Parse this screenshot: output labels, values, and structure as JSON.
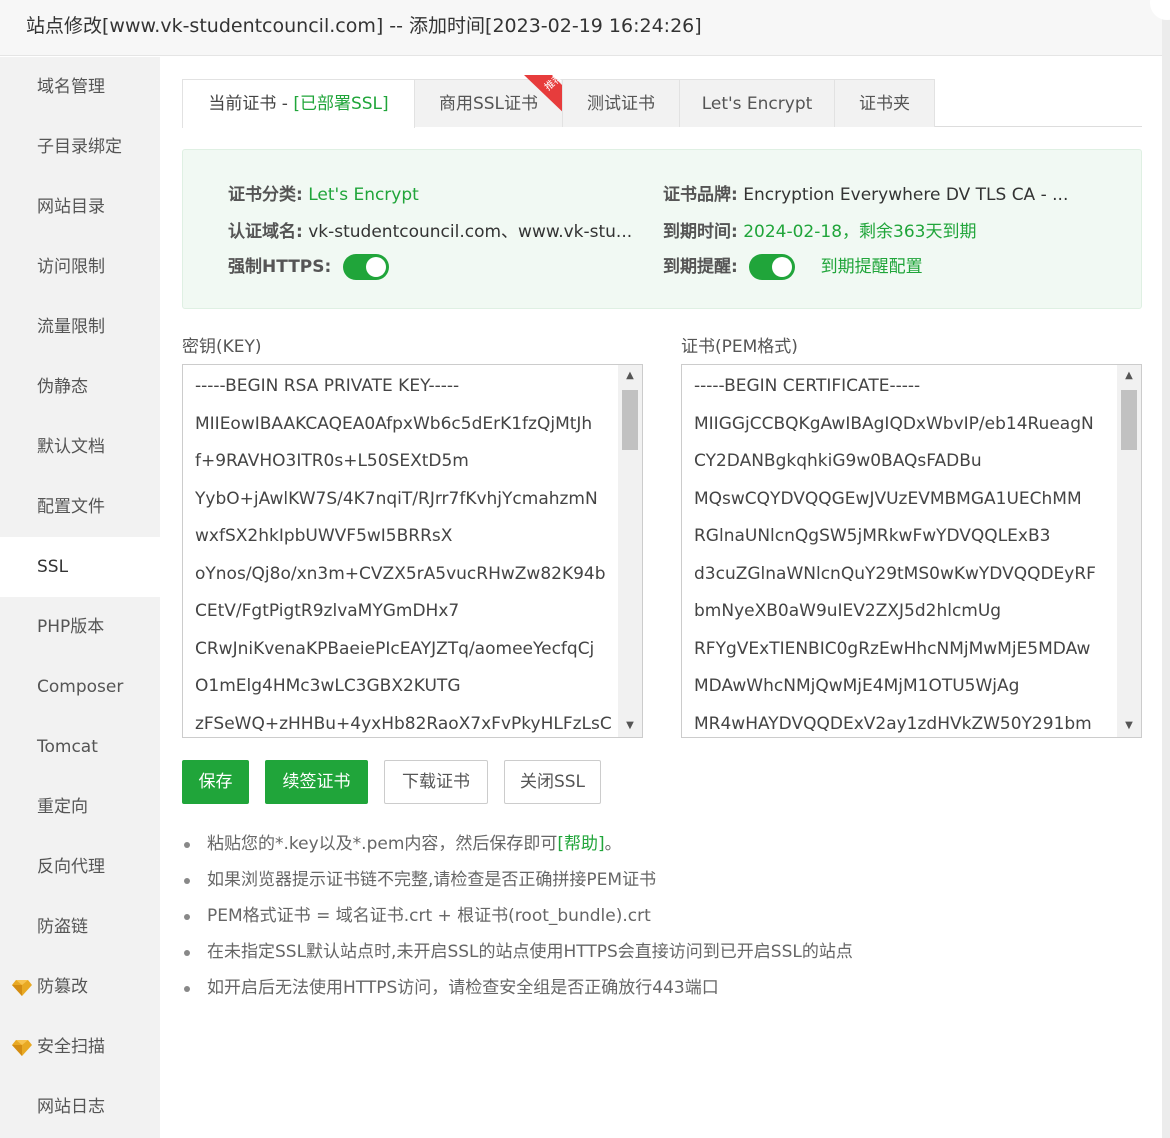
{
  "title": "站点修改[www.vk-studentcouncil.com] -- 添加时间[2023-02-19 16:24:26]",
  "sidebar": {
    "items": [
      {
        "label": "域名管理"
      },
      {
        "label": "子目录绑定"
      },
      {
        "label": "网站目录"
      },
      {
        "label": "访问限制"
      },
      {
        "label": "流量限制"
      },
      {
        "label": "伪静态"
      },
      {
        "label": "默认文档"
      },
      {
        "label": "配置文件"
      },
      {
        "label": "SSL"
      },
      {
        "label": "PHP版本"
      },
      {
        "label": "Composer"
      },
      {
        "label": "Tomcat"
      },
      {
        "label": "重定向"
      },
      {
        "label": "反向代理"
      },
      {
        "label": "防盗链"
      },
      {
        "label": "防篡改"
      },
      {
        "label": "安全扫描"
      },
      {
        "label": "网站日志"
      }
    ],
    "active": "SSL"
  },
  "tabs": {
    "current": "当前证书 - ",
    "current_status": "[已部署SSL]",
    "commercial": "商用SSL证书",
    "ribbon": "推荐",
    "test": "测试证书",
    "letsencrypt": "Let's Encrypt",
    "folder": "证书夹"
  },
  "cert_info": {
    "category_label": "证书分类:",
    "category_value": "Let's Encrypt",
    "brand_label": "证书品牌:",
    "brand_value": "Encryption Everywhere DV TLS CA - ...",
    "domain_label": "认证域名:",
    "domain_value": "vk-studentcouncil.com、www.vk-stu...",
    "expiry_label": "到期时间:",
    "expiry_value": "2024-02-18，剩余363天到期",
    "https_label": "强制HTTPS:",
    "https_on": true,
    "reminder_label": "到期提醒:",
    "reminder_on": true,
    "reminder_config": "到期提醒配置"
  },
  "key": {
    "label": "密钥(KEY)",
    "lines": [
      "-----BEGIN RSA PRIVATE KEY-----",
      "MIIEowIBAAKCAQEA0AfpxWb6c5dErK1fzQjMtJh",
      "f+9RAVHO3ITR0s+L50SEXtD5m",
      "YybO+jAwlKW7S/4K7nqiT/RJrr7fKvhjYcmahzmN",
      "wxfSX2hkIpbUWVF5wI5BRRsX",
      "oYnos/Qj8o/xn3m+CVZX5rA5vucRHwZw82K94b",
      "CEtV/FgtPigtR9zlvaMYGmDHx7",
      "CRwJniKvenaKPBaeiePIcEAYJZTq/aomeeYecfqCj",
      "O1mElg4HMc3wLC3GBX2KUTG",
      "zFSeWQ+zHHBu+4yxHb82RaoX7xFvPkyHLFzLsC"
    ]
  },
  "cert": {
    "label": "证书(PEM格式)",
    "lines": [
      "-----BEGIN CERTIFICATE-----",
      "MIIGGjCCBQKgAwIBAgIQDxWbvIP/eb14RueagN",
      "CY2DANBgkqhkiG9w0BAQsFADBu",
      "MQswCQYDVQQGEwJVUzEVMBMGA1UEChMM",
      "RGlnaUNlcnQgSW5jMRkwFwYDVQQLExB3",
      "d3cuZGlnaWNlcnQuY29tMS0wKwYDVQQDEyRF",
      "bmNyeXB0aW9uIEV2ZXJ5d2hlcmUg",
      "RFYgVExTIENBIC0gRzEwHhcNMjMwMjE5MDAw",
      "MDAwWhcNMjQwMjE4MjM1OTU5WjAg",
      "MR4wHAYDVQQDExV2ay1zdHVkZW50Y291bm"
    ]
  },
  "buttons": {
    "save": "保存",
    "renew": "续签证书",
    "download": "下载证书",
    "close_ssl": "关闭SSL"
  },
  "tips": {
    "t1_pre": "粘贴您的*.key以及*.pem内容，然后保存即可",
    "t1_help": "[帮助]",
    "t1_post": "。",
    "t2": "如果浏览器提示证书链不完整,请检查是否正确拼接PEM证书",
    "t3": "PEM格式证书 = 域名证书.crt + 根证书(root_bundle).crt",
    "t4": "在未指定SSL默认站点时,未开启SSL的站点使用HTTPS会直接访问到已开启SSL的站点",
    "t5": "如开启后无法使用HTTPS访问，请检查安全组是否正确放行443端口"
  },
  "colors": {
    "accent": "#20a53a",
    "info_bg": "#f1f9f3",
    "sidebar_bg": "#f2f2f2"
  }
}
